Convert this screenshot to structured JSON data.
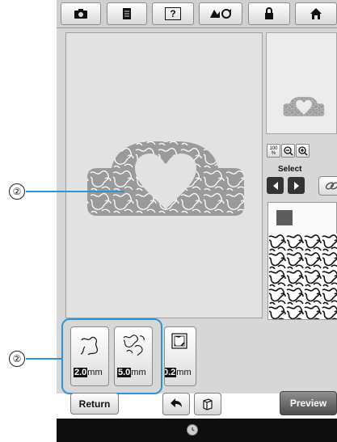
{
  "toolbar": {
    "icons": [
      "camera-icon",
      "document-icon",
      "help-icon",
      "pattern-settings-icon",
      "lock-icon",
      "home-icon"
    ],
    "help_label": "?"
  },
  "right_panel": {
    "zoom_level": "100\n%",
    "zoom_level_top": "100",
    "zoom_level_bottom": "%",
    "select_label": "Select"
  },
  "settings": {
    "buttons": [
      {
        "name": "stipple-spacing",
        "value": "2.0",
        "unit": "mm"
      },
      {
        "name": "stipple-distance",
        "value": "5.0",
        "unit": "mm"
      },
      {
        "name": "third-setting",
        "value": "0.2",
        "unit": "mm"
      }
    ]
  },
  "bottom": {
    "return_label": "Return",
    "preview_label": "Preview"
  },
  "callouts": {
    "shape_marker": "②",
    "settings_marker": "②"
  },
  "colors": {
    "highlight": "#2e94d6",
    "panel": "#d7d7d7",
    "shape_fill": "#8f8f8f"
  }
}
